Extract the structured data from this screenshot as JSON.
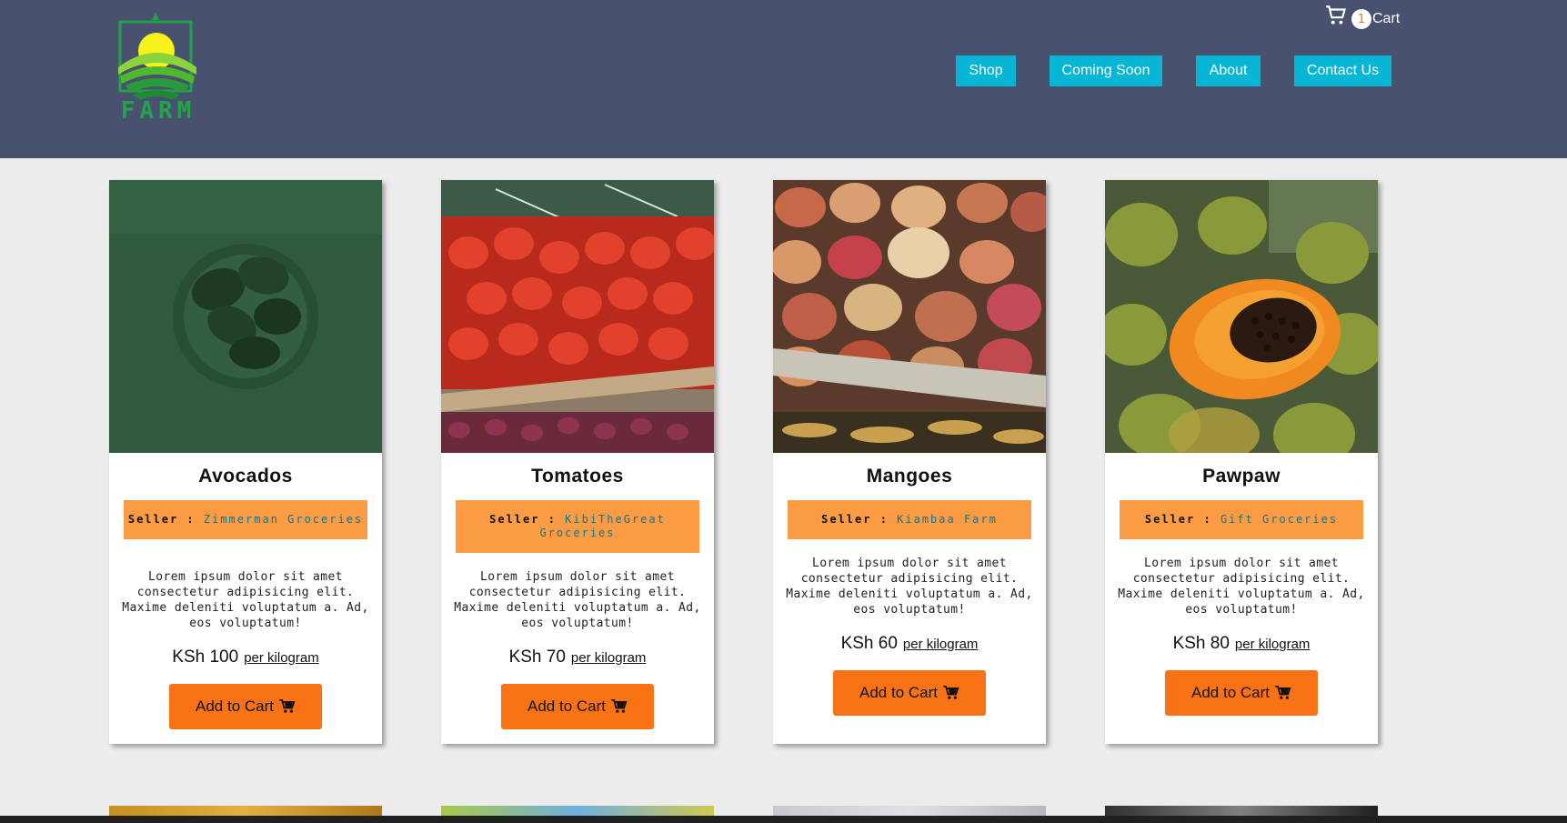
{
  "brand": {
    "logo_text": "FARM"
  },
  "cart": {
    "count": "1",
    "label": "Cart",
    "icon": "cart-icon"
  },
  "nav": [
    {
      "label": "Shop"
    },
    {
      "label": "Coming Soon"
    },
    {
      "label": "About"
    },
    {
      "label": "Contact Us"
    }
  ],
  "products": [
    {
      "name": "Avocados",
      "seller_prefix": "Seller : ",
      "seller_name": "Zimmerman Groceries",
      "description": "Lorem ipsum dolor sit amet consectetur adipisicing elit. Maxime deleniti voluptatum a. Ad, eos voluptatum!",
      "price": "KSh 100",
      "unit": "per kilogram",
      "button": "Add to Cart"
    },
    {
      "name": "Tomatoes",
      "seller_prefix": "Seller : ",
      "seller_name": "KibiTheGreat Groceries",
      "description": "Lorem ipsum dolor sit amet consectetur adipisicing elit. Maxime deleniti voluptatum a. Ad, eos voluptatum!",
      "price": "KSh 70",
      "unit": "per kilogram",
      "button": "Add to Cart"
    },
    {
      "name": "Mangoes",
      "seller_prefix": "Seller : ",
      "seller_name": "Kiambaa Farm",
      "description": "Lorem ipsum dolor sit amet consectetur adipisicing elit. Maxime deleniti voluptatum a. Ad, eos voluptatum!",
      "price": "KSh 60",
      "unit": "per kilogram",
      "button": "Add to Cart"
    },
    {
      "name": "Pawpaw",
      "seller_prefix": "Seller : ",
      "seller_name": "Gift Groceries",
      "description": "Lorem ipsum dolor sit amet consectetur adipisicing elit. Maxime deleniti voluptatum a. Ad, eos voluptatum!",
      "price": "KSh 80",
      "unit": "per kilogram",
      "button": "Add to Cart"
    }
  ],
  "colors": {
    "header": "#48526f",
    "nav_button": "#06b6d4",
    "seller_band": "#fb9c45",
    "cart_button": "#f97316",
    "background": "#ececec"
  }
}
